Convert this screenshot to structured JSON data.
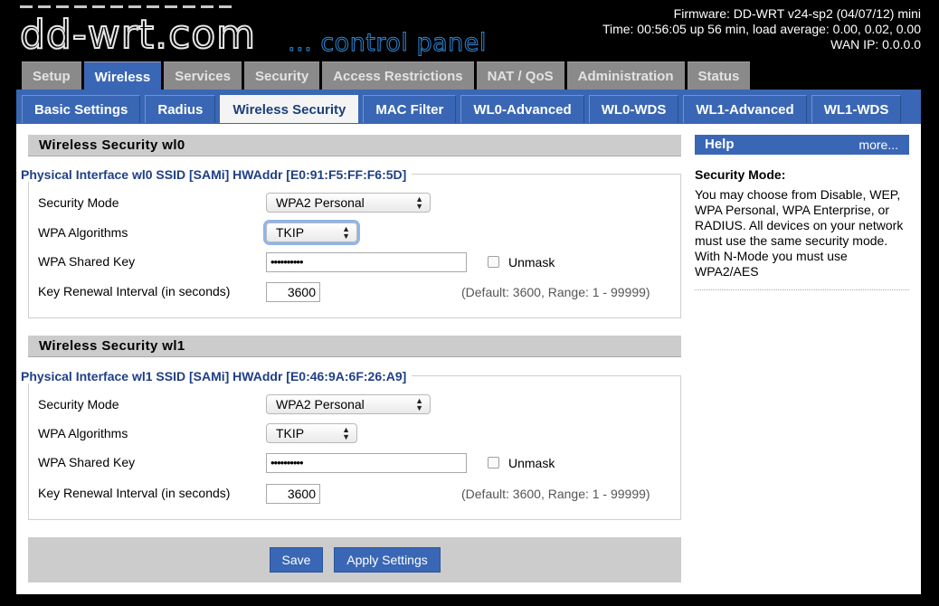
{
  "header": {
    "logo_main": "dd-wrt",
    "logo_suffix": ".com",
    "subtitle": "... control panel",
    "firmware": "Firmware: DD-WRT v24-sp2 (04/07/12) mini",
    "time": "Time: 00:56:05 up 56 min, load average: 0.00, 0.02, 0.00",
    "wan_ip": "WAN IP: 0.0.0.0"
  },
  "main_tabs": [
    {
      "label": "Setup"
    },
    {
      "label": "Wireless"
    },
    {
      "label": "Services"
    },
    {
      "label": "Security"
    },
    {
      "label": "Access Restrictions"
    },
    {
      "label": "NAT / QoS"
    },
    {
      "label": "Administration"
    },
    {
      "label": "Status"
    }
  ],
  "sub_tabs": [
    {
      "label": "Basic Settings"
    },
    {
      "label": "Radius"
    },
    {
      "label": "Wireless Security"
    },
    {
      "label": "MAC Filter"
    },
    {
      "label": "WL0-Advanced"
    },
    {
      "label": "WL0-WDS"
    },
    {
      "label": "WL1-Advanced"
    },
    {
      "label": "WL1-WDS"
    }
  ],
  "wl0": {
    "title": "Wireless Security wl0",
    "interface": "Physical Interface wl0 SSID [SAMi] HWAddr [E0:91:F5:FF:F6:5D]",
    "security_mode_label": "Security Mode",
    "security_mode_value": "WPA2 Personal",
    "wpa_algorithms_label": "WPA Algorithms",
    "wpa_algorithms_value": "TKIP",
    "shared_key_label": "WPA Shared Key",
    "shared_key_value": "••••••••••",
    "unmask_label": "Unmask",
    "renewal_label": "Key Renewal Interval (in seconds)",
    "renewal_value": "3600",
    "renewal_hint": "(Default: 3600, Range: 1 - 99999)"
  },
  "wl1": {
    "title": "Wireless Security wl1",
    "interface": "Physical Interface wl1 SSID [SAMi] HWAddr [E0:46:9A:6F:26:A9]",
    "security_mode_label": "Security Mode",
    "security_mode_value": "WPA2 Personal",
    "wpa_algorithms_label": "WPA Algorithms",
    "wpa_algorithms_value": "TKIP",
    "shared_key_label": "WPA Shared Key",
    "shared_key_value": "••••••••••",
    "unmask_label": "Unmask",
    "renewal_label": "Key Renewal Interval (in seconds)",
    "renewal_value": "3600",
    "renewal_hint": "(Default: 3600, Range: 1 - 99999)"
  },
  "buttons": {
    "save": "Save",
    "apply": "Apply Settings"
  },
  "help": {
    "title": "Help",
    "more": "more...",
    "heading": "Security Mode:",
    "text": "You may choose from Disable, WEP, WPA Personal, WPA Enterprise, or RADIUS. All devices on your network must use the same security mode. With N-Mode you must use WPA2/AES"
  },
  "colors": {
    "accent": "#3a67b5",
    "tab_inactive": "#8a8a8a",
    "section_bg": "#cccccc"
  }
}
